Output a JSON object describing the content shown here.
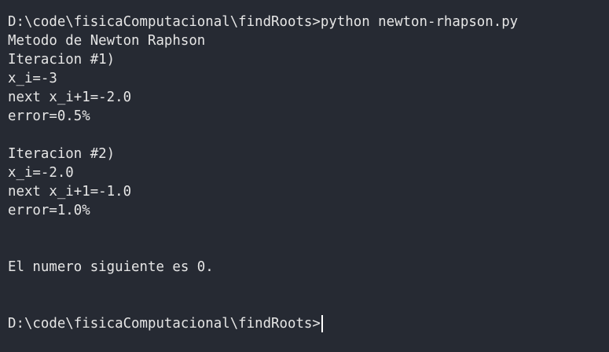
{
  "terminal": {
    "colors": {
      "background": "#262a33",
      "text": "#e6e6e6",
      "cursor": "#ffffff"
    },
    "lines": [
      "D:\\code\\fisicaComputacional\\findRoots>python newton-rhapson.py",
      "Metodo de Newton Raphson",
      "Iteracion #1)",
      "x_i=-3",
      "next x_i+1=-2.0",
      "error=0.5%",
      "",
      "Iteracion #2)",
      "x_i=-2.0",
      "next x_i+1=-1.0",
      "error=1.0%",
      "",
      "",
      "El numero siguiente es 0.",
      "",
      ""
    ],
    "prompt": "D:\\code\\fisicaComputacional\\findRoots>"
  }
}
